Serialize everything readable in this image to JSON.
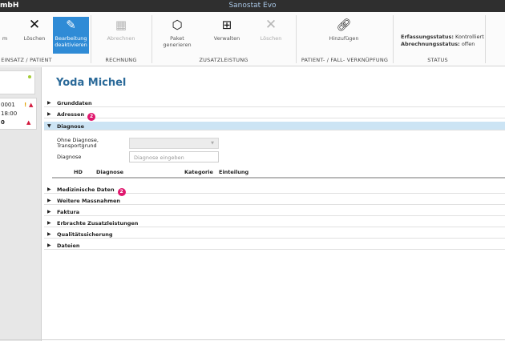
{
  "titlebar": {
    "company": "mbH",
    "app_title": "Sanostat Evo"
  },
  "ribbon": {
    "buttons": [
      {
        "id": "cut1",
        "label": "m",
        "icon": "truncated-icon"
      },
      {
        "id": "delete",
        "label": "Löschen",
        "icon": "x-icon"
      },
      {
        "id": "edit",
        "label": "Bearbeitung deaktivieren",
        "icon": "edit-icon"
      },
      {
        "id": "bill",
        "label": "Abrechnen",
        "icon": "calculator-icon"
      },
      {
        "id": "package",
        "label": "Paket generieren",
        "icon": "package-icon"
      },
      {
        "id": "manage",
        "label": "Verwalten",
        "icon": "medkit-icon"
      },
      {
        "id": "delete2",
        "label": "Löschen",
        "icon": "x-icon"
      },
      {
        "id": "link",
        "label": "Hinzufügen",
        "icon": "link-icon"
      }
    ],
    "groups": {
      "einsatz": "EINSATZ / PATIENT",
      "rechnung": "RECHNUNG",
      "zusatz": "ZUSATZLEISTUNG",
      "verknuepfung": "PATIENT- / FALL- VERKNÜPFUNG",
      "status": "STATUS"
    },
    "status": {
      "erfassung_label": "Erfassungsstatus:",
      "erfassung_value": "Kontrolliert",
      "abrechnung_label": "Abrechnungsstatus:",
      "abrechnung_value": "offen"
    }
  },
  "left": {
    "row1": "0001",
    "row1_mark": "!",
    "row2": "18:00",
    "row3": "0"
  },
  "patient": {
    "name": "Yoda Michel"
  },
  "sections": [
    {
      "label": "Grunddaten",
      "badge": ""
    },
    {
      "label": "Adressen",
      "badge": "2"
    },
    {
      "label": "Diagnose",
      "badge": ""
    },
    {
      "label": "Medizinische Daten",
      "badge": "2"
    },
    {
      "label": "Weitere Massnahmen",
      "badge": ""
    },
    {
      "label": "Faktura",
      "badge": ""
    },
    {
      "label": "Erbrachte Zusatzleistungen",
      "badge": ""
    },
    {
      "label": "Qualitätssicherung",
      "badge": ""
    },
    {
      "label": "Dateien",
      "badge": ""
    }
  ],
  "diagnose": {
    "no_diag_label": "Ohne Diagnose, Transportgrund",
    "diag_label": "Diagnose",
    "placeholder": "Diagnose eingeben",
    "columns": [
      "HD",
      "Diagnose",
      "Kategorie",
      "Einteilung"
    ]
  },
  "colors": {
    "accent": "#2f8bd6",
    "title": "#2b6a99",
    "badge": "#e0186e",
    "active_section": "#cce4f4"
  }
}
